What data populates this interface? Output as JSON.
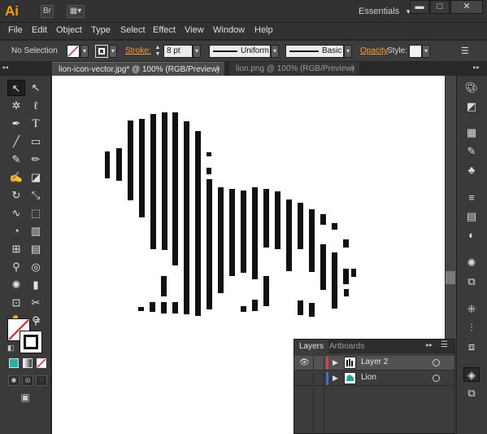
{
  "app": {
    "logo_text": "Ai",
    "workspace": "Essentials",
    "accent": "#ff9a00"
  },
  "menu": [
    "File",
    "Edit",
    "Object",
    "Type",
    "Select",
    "Effect",
    "View",
    "Window",
    "Help"
  ],
  "control_bar": {
    "selection_status": "No Selection",
    "stroke_label": "Stroke:",
    "stroke_value": "8 pt",
    "profile_label": "Uniform",
    "brush_label": "Basic",
    "opacity_label": "Opacity",
    "style_label": "Style:"
  },
  "tabs": [
    {
      "label": "lion-icon-vector.jpg* @ 100% (RGB/Preview)",
      "active": true
    },
    {
      "label": "lion.png @ 100% (RGB/Preview)",
      "active": false
    }
  ],
  "layers_panel": {
    "tabs": [
      "Layers",
      "Artboards"
    ],
    "layers": [
      {
        "name": "Layer 2",
        "color": "#e0394b",
        "selected": true
      },
      {
        "name": "Lion",
        "color": "#3f6cd8",
        "selected": false
      }
    ]
  },
  "tool_icons": [
    "selection-tool-icon",
    "direct-selection-tool-icon",
    "magic-wand-icon",
    "lasso-icon",
    "pen-icon",
    "type-icon",
    "line-icon",
    "rectangle-icon",
    "paintbrush-icon",
    "pencil-icon",
    "blob-brush-icon",
    "eraser-icon",
    "rotate-icon",
    "scale-icon",
    "warp-icon",
    "free-transform-icon",
    "shape-builder-icon",
    "perspective-grid-icon",
    "mesh-icon",
    "gradient-icon",
    "eyedropper-icon",
    "blend-icon",
    "symbol-sprayer-icon",
    "column-graph-icon",
    "artboard-icon",
    "slice-icon",
    "hand-icon",
    "zoom-icon"
  ],
  "dock_icons": [
    "color-icon",
    "color-guide-icon",
    "swatches-icon",
    "brushes-icon",
    "symbols-icon",
    "stroke-icon",
    "gradient-panel-icon",
    "transparency-icon",
    "appearance-icon",
    "graphic-styles-icon",
    "transform-icon",
    "align-icon",
    "pathfinder-icon",
    "layers-panel-icon",
    "artboards-panel-icon"
  ]
}
